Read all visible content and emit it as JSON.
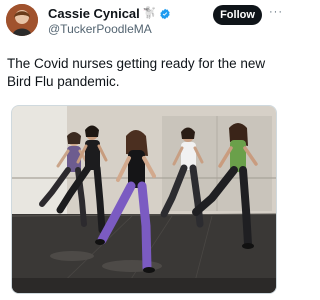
{
  "tweet": {
    "author_name": "Cassie Cynical",
    "name_emoji": "🐩",
    "handle": "@TuckerPoodleMA",
    "follow_label": "Follow",
    "more_label": "···",
    "text": "The Covid nurses getting ready for the new Bird Flu pandemic."
  },
  "colors": {
    "verified": "#1d9bf0",
    "follow_bg": "#0f1419",
    "text": "#0f1419",
    "secondary": "#536471"
  }
}
